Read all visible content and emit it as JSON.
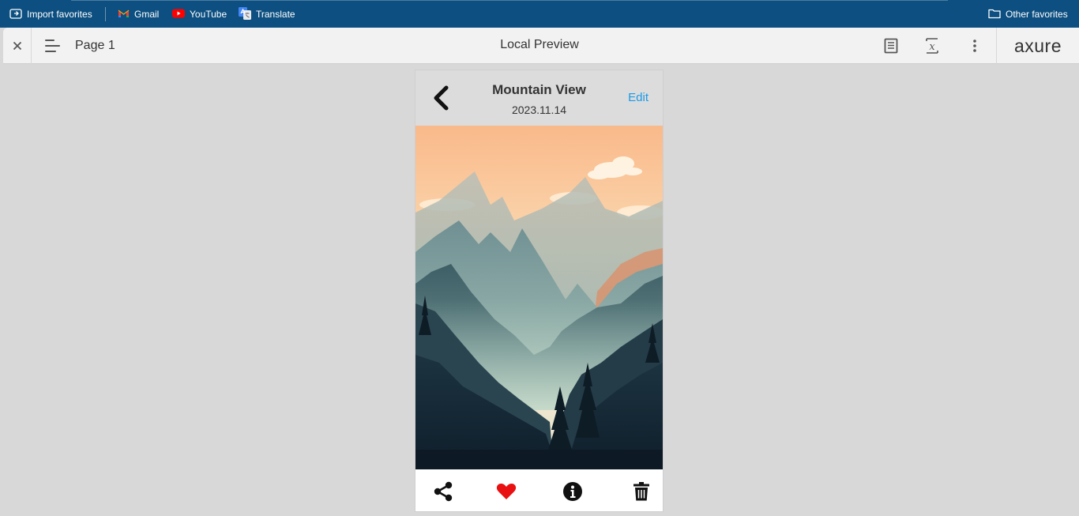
{
  "favorites_bar": {
    "import": {
      "label": "Import favorites",
      "icon": "import-favorites-icon"
    },
    "items": [
      {
        "label": "Gmail",
        "icon": "gmail-icon"
      },
      {
        "label": "YouTube",
        "icon": "youtube-icon"
      },
      {
        "label": "Translate",
        "icon": "translate-icon"
      }
    ],
    "other": {
      "label": "Other favorites",
      "icon": "folder-icon"
    }
  },
  "toolbar": {
    "close_icon": "close-icon",
    "menu_icon": "hamburger-menu-icon",
    "page_label": "Page 1",
    "title": "Local Preview",
    "notes_icon": "notes-icon",
    "variables_icon": "variables-icon",
    "more_icon": "more-vertical-icon",
    "logo": "axure"
  },
  "phone": {
    "header": {
      "back_icon": "chevron-left-icon",
      "title": "Mountain View",
      "date": "2023.11.14",
      "edit_label": "Edit"
    },
    "image": "mountain-landscape-illustration",
    "actions": [
      {
        "icon": "share-icon"
      },
      {
        "icon": "heart-icon",
        "color": "#e81010"
      },
      {
        "icon": "info-icon"
      },
      {
        "icon": "trash-icon"
      }
    ]
  },
  "colors": {
    "favbar_bg": "#0c4f80",
    "toolbar_bg": "#f2f2f2",
    "canvas_bg": "#d8d8d8",
    "edit_link": "#1a9ae6",
    "heart": "#e81010"
  }
}
